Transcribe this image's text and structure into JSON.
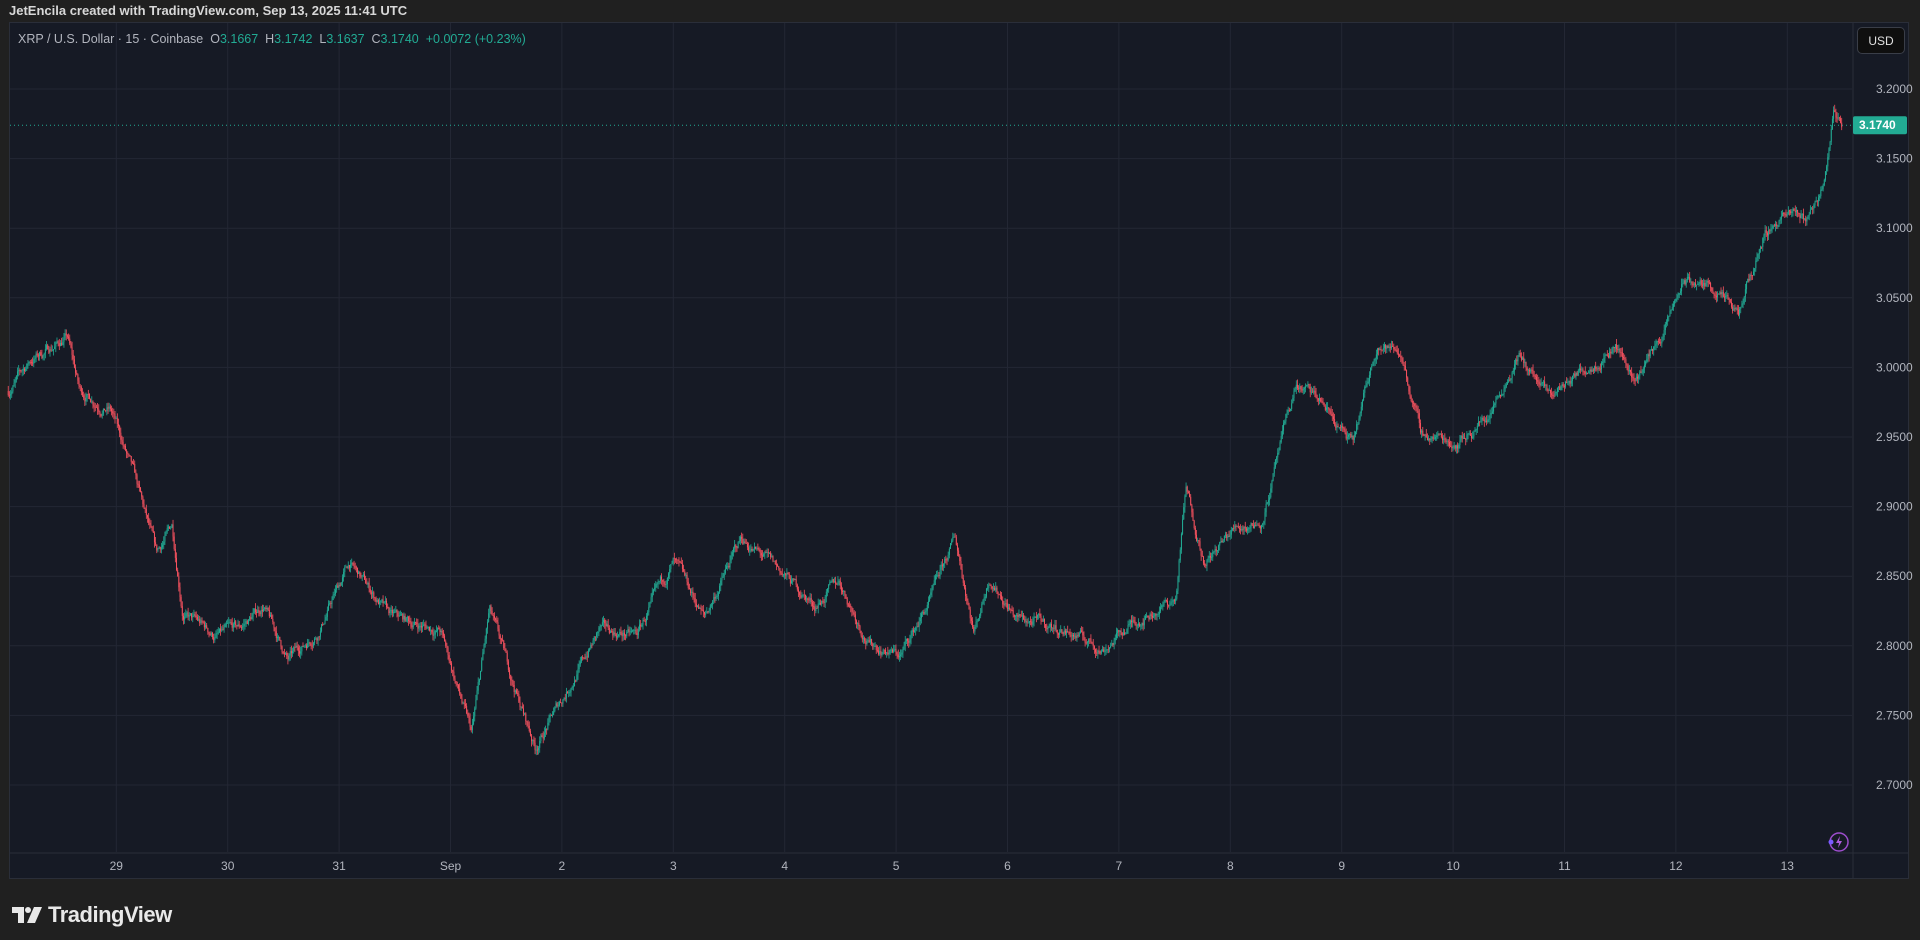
{
  "header": {
    "caption": "JetEncila created with TradingView.com, Sep 13, 2025 11:41 UTC"
  },
  "legend": {
    "symbol": "XRP / U.S. Dollar · 15 · Coinbase",
    "o_label": "O",
    "o": "3.1667",
    "h_label": "H",
    "h": "3.1742",
    "l_label": "L",
    "l": "3.1637",
    "c_label": "C",
    "c": "3.1740",
    "change": "+0.0072 (+0.23%)"
  },
  "currency_button": "USD",
  "brand": "TradingView",
  "colors": {
    "up": "#22ab94",
    "down": "#f7525f",
    "background": "#161a25",
    "grid": "#232734"
  },
  "chart_data": {
    "type": "candlestick",
    "title": "XRP / U.S. Dollar · 15 · Coinbase",
    "interval_minutes": 15,
    "last_price": 3.174,
    "last_price_label": "3.1740",
    "ylim": [
      2.66,
      3.235
    ],
    "y_ticks": [
      "3.2000",
      "3.1500",
      "3.1000",
      "3.0500",
      "3.0000",
      "2.9500",
      "2.9000",
      "2.8500",
      "2.8000",
      "2.7500",
      "2.7000"
    ],
    "x_ticks": [
      "29",
      "30",
      "31",
      "Sep",
      "2",
      "3",
      "4",
      "5",
      "6",
      "7",
      "8",
      "9",
      "10",
      "11",
      "12",
      "13"
    ],
    "x_range_days_from_aug29": [
      -0.97,
      15.49
    ],
    "grid": true,
    "close_path_day_price": [
      [
        -0.97,
        2.983
      ],
      [
        -0.77,
        3.005
      ],
      [
        -0.44,
        3.022
      ],
      [
        -0.33,
        2.983
      ],
      [
        -0.05,
        2.97
      ],
      [
        0.16,
        2.921
      ],
      [
        0.36,
        2.864
      ],
      [
        0.5,
        2.886
      ],
      [
        0.6,
        2.824
      ],
      [
        0.88,
        2.807
      ],
      [
        1.1,
        2.811
      ],
      [
        1.32,
        2.829
      ],
      [
        1.54,
        2.789
      ],
      [
        1.81,
        2.811
      ],
      [
        2.09,
        2.859
      ],
      [
        2.47,
        2.82
      ],
      [
        2.91,
        2.811
      ],
      [
        3.19,
        2.736
      ],
      [
        3.35,
        2.824
      ],
      [
        3.57,
        2.771
      ],
      [
        3.76,
        2.727
      ],
      [
        4.01,
        2.763
      ],
      [
        4.34,
        2.811
      ],
      [
        4.67,
        2.807
      ],
      [
        5.0,
        2.859
      ],
      [
        5.28,
        2.82
      ],
      [
        5.61,
        2.877
      ],
      [
        5.99,
        2.851
      ],
      [
        6.27,
        2.829
      ],
      [
        6.49,
        2.846
      ],
      [
        6.76,
        2.802
      ],
      [
        7.04,
        2.793
      ],
      [
        7.31,
        2.833
      ],
      [
        7.53,
        2.877
      ],
      [
        7.7,
        2.811
      ],
      [
        7.84,
        2.851
      ],
      [
        8.08,
        2.82
      ],
      [
        8.52,
        2.811
      ],
      [
        8.85,
        2.798
      ],
      [
        9.18,
        2.82
      ],
      [
        9.51,
        2.833
      ],
      [
        9.6,
        2.912
      ],
      [
        9.78,
        2.859
      ],
      [
        10.06,
        2.886
      ],
      [
        10.28,
        2.89
      ],
      [
        10.44,
        2.939
      ],
      [
        10.59,
        2.987
      ],
      [
        10.83,
        2.974
      ],
      [
        11.1,
        2.943
      ],
      [
        11.32,
        3.018
      ],
      [
        11.54,
        3.009
      ],
      [
        11.71,
        2.952
      ],
      [
        12.04,
        2.947
      ],
      [
        12.31,
        2.965
      ],
      [
        12.58,
        3.009
      ],
      [
        12.86,
        2.978
      ],
      [
        13.19,
        3.0
      ],
      [
        13.46,
        3.018
      ],
      [
        13.63,
        2.991
      ],
      [
        13.9,
        3.027
      ],
      [
        14.07,
        3.062
      ],
      [
        14.34,
        3.057
      ],
      [
        14.56,
        3.035
      ],
      [
        14.78,
        3.093
      ],
      [
        14.95,
        3.11
      ],
      [
        15.17,
        3.106
      ],
      [
        15.33,
        3.132
      ],
      [
        15.42,
        3.185
      ],
      [
        15.49,
        3.174
      ]
    ]
  }
}
